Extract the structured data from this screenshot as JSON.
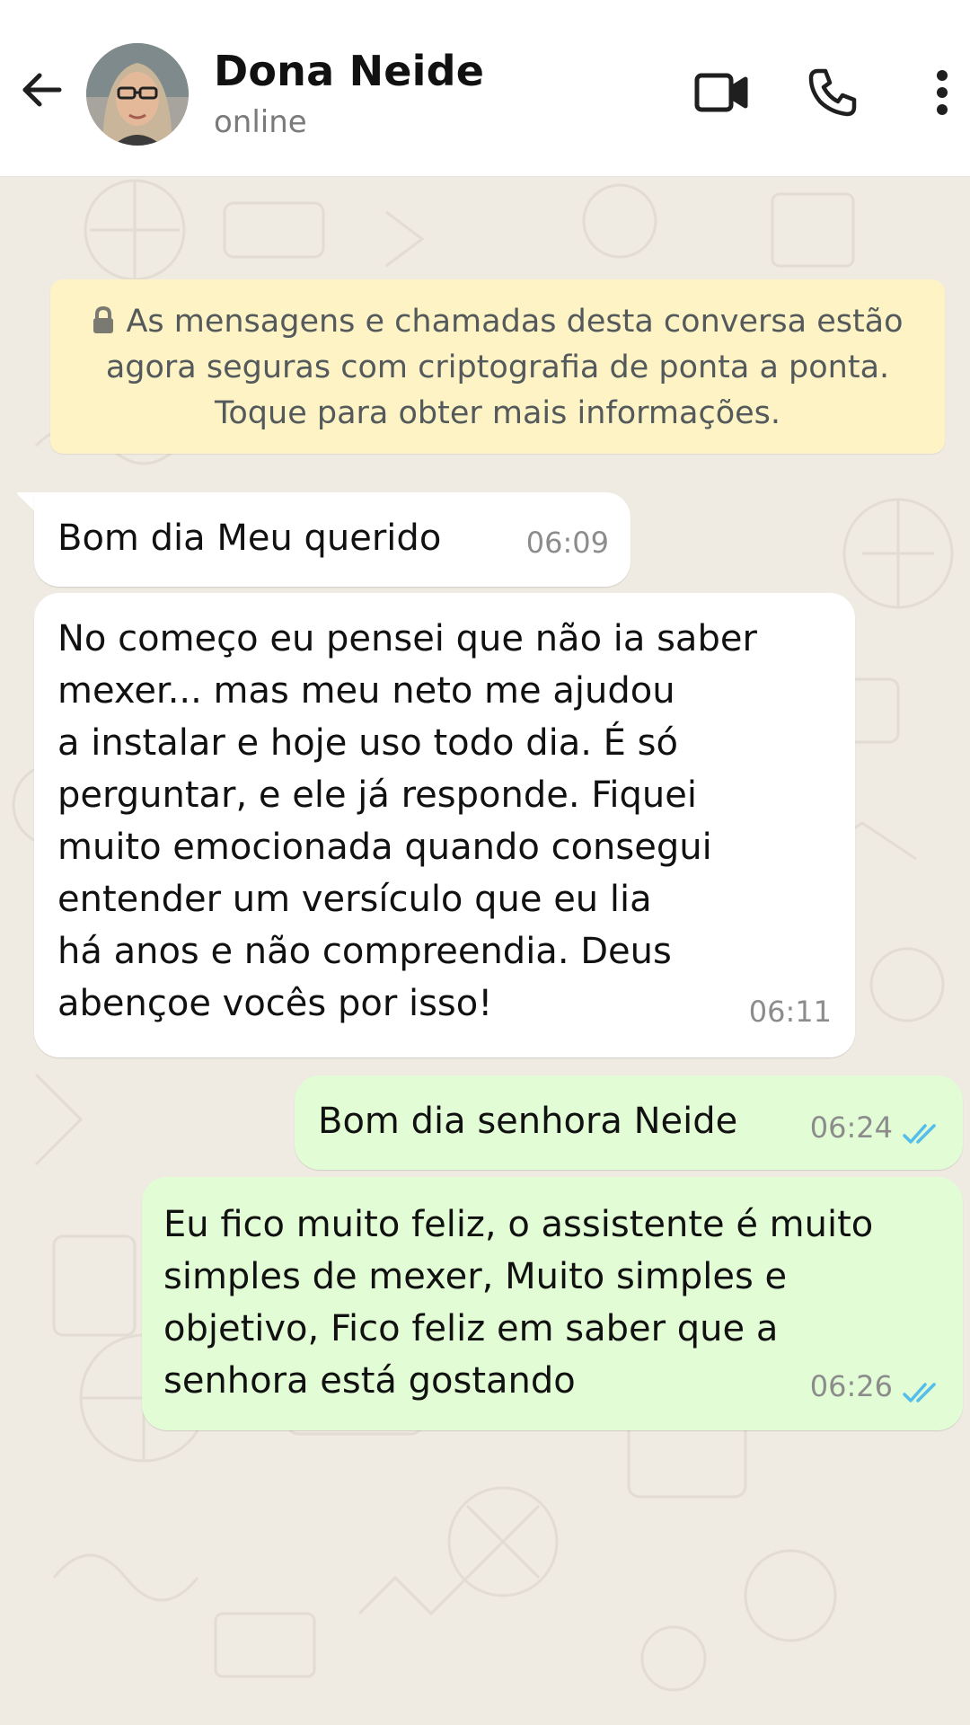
{
  "header": {
    "contact_name": "Dona Neide",
    "status": "online",
    "back_icon": "arrow-left-icon",
    "video_icon": "video-camera-icon",
    "call_icon": "phone-icon",
    "menu_icon": "more-vertical-icon"
  },
  "encryption_notice": {
    "text": "As mensagens e chamadas desta conversa estão agora seguras com criptografia de ponta a ponta. Toque para obter mais informações.",
    "icon": "lock-icon",
    "background": "#fdf3c4"
  },
  "messages": [
    {
      "direction": "incoming",
      "text": "Bom dia Meu querido",
      "time": "06:09"
    },
    {
      "direction": "incoming",
      "text": "No começo eu pensei que não ia saber\nmexer... mas meu neto me ajudou\na instalar e hoje uso todo dia. É só\nperguntar, e ele já responde. Fiquei\nmuito emocionada quando consegui\nentender um versículo que eu lia\nhá anos e não compreendia. Deus\nabençoe vocês por isso!",
      "time": "06:11"
    },
    {
      "direction": "outgoing",
      "text": "Bom dia senhora Neide",
      "time": "06:24",
      "status": "read"
    },
    {
      "direction": "outgoing",
      "text": "Eu fico muito feliz, o assistente é muito\nsimples de mexer, Muito simples e\nobjetivo, Fico feliz em saber que a\nsenhora está gostando",
      "time": "06:26",
      "status": "read"
    }
  ],
  "colors": {
    "incoming_bubble": "#ffffff",
    "outgoing_bubble": "#e2fdd5",
    "read_ticks": "#53bdeb",
    "chat_background": "#efeae2"
  }
}
